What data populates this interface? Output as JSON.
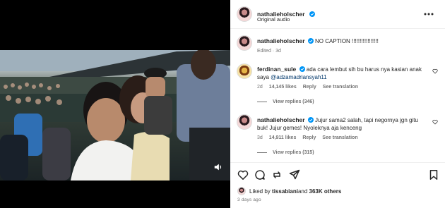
{
  "post": {
    "username": "nathalieholscher",
    "subtitle": "Original audio"
  },
  "caption": {
    "username": "nathalieholscher",
    "text": "NO CAPTION !!!!!!!!!!!!!!!!!",
    "meta": "Edited · 3d"
  },
  "comments": [
    {
      "username": "ferdinan_sule",
      "text": "ada cara lembut sih bu harus nya kasian anak saya ",
      "mention": "@adzamadriansyah11",
      "age": "2d",
      "likes": "14,145 likes",
      "reply": "Reply",
      "translate": "See translation",
      "replies": "View replies (346)"
    },
    {
      "username": "nathalieholscher",
      "text": "Jujur sama2 salah, tapi negornya jgn gitu buk! Jujur gemes! Nyoleknya aja kenceng",
      "age": "3d",
      "likes": "14,911 likes",
      "reply": "Reply",
      "translate": "See translation",
      "replies": "View replies (315)"
    }
  ],
  "likes": {
    "prefix": "Liked by ",
    "user": "tissabiani",
    "connector": " and ",
    "others": "363K others"
  },
  "posted": "3 days ago",
  "icons": [
    "verified-badge-icon",
    "more-options-icon",
    "heart-icon",
    "comment-icon",
    "share-icon",
    "bookmark-icon",
    "speaker-icon"
  ],
  "colors": {
    "verified": "#0095f6",
    "secondary_text": "#737373",
    "link": "#00376b"
  }
}
